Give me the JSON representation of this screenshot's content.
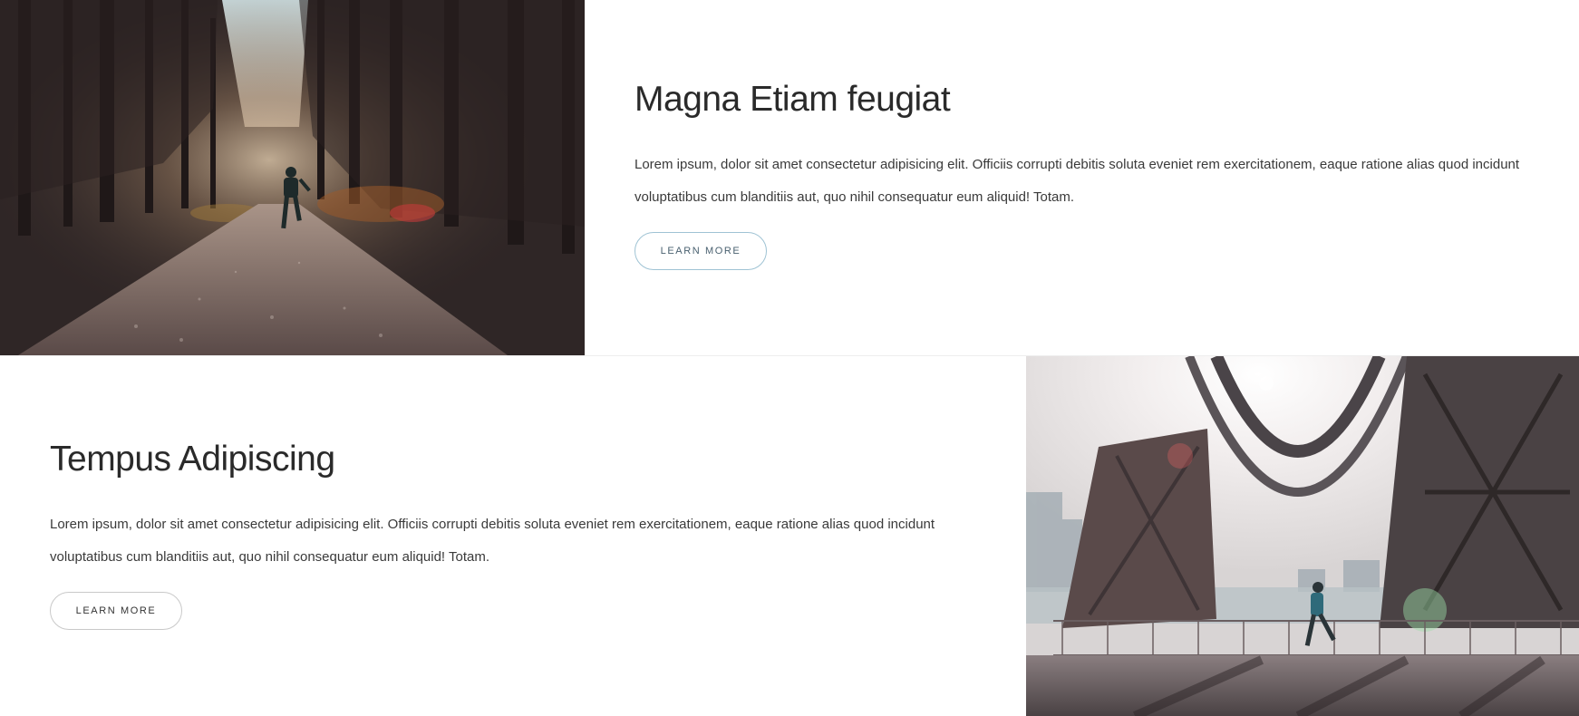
{
  "sections": [
    {
      "heading": "Magna Etiam feugiat",
      "body": "Lorem ipsum, dolor sit amet consectetur adipisicing elit. Officiis corrupti debitis soluta eveniet rem exercitationem, eaque ratione alias quod incidunt voluptatibus cum blanditiis aut, quo nihil consequatur eum aliquid! Totam.",
      "button_label": "LEARN MORE",
      "image": "forest-trail-runner-photo"
    },
    {
      "heading": "Tempus Adipiscing",
      "body": "Lorem ipsum, dolor sit amet consectetur adipisicing elit. Officiis corrupti debitis soluta eveniet rem exercitationem, eaque ratione alias quod incidunt voluptatibus cum blanditiis aut, quo nihil consequatur eum aliquid! Totam.",
      "button_label": "LEARN MORE",
      "image": "bridge-runner-photo"
    }
  ],
  "colors": {
    "accent_border": "#9fc3d4",
    "neutral_border": "#c9c9c9",
    "heading": "#2a2a2a",
    "forest_dark": "#2f2626"
  }
}
